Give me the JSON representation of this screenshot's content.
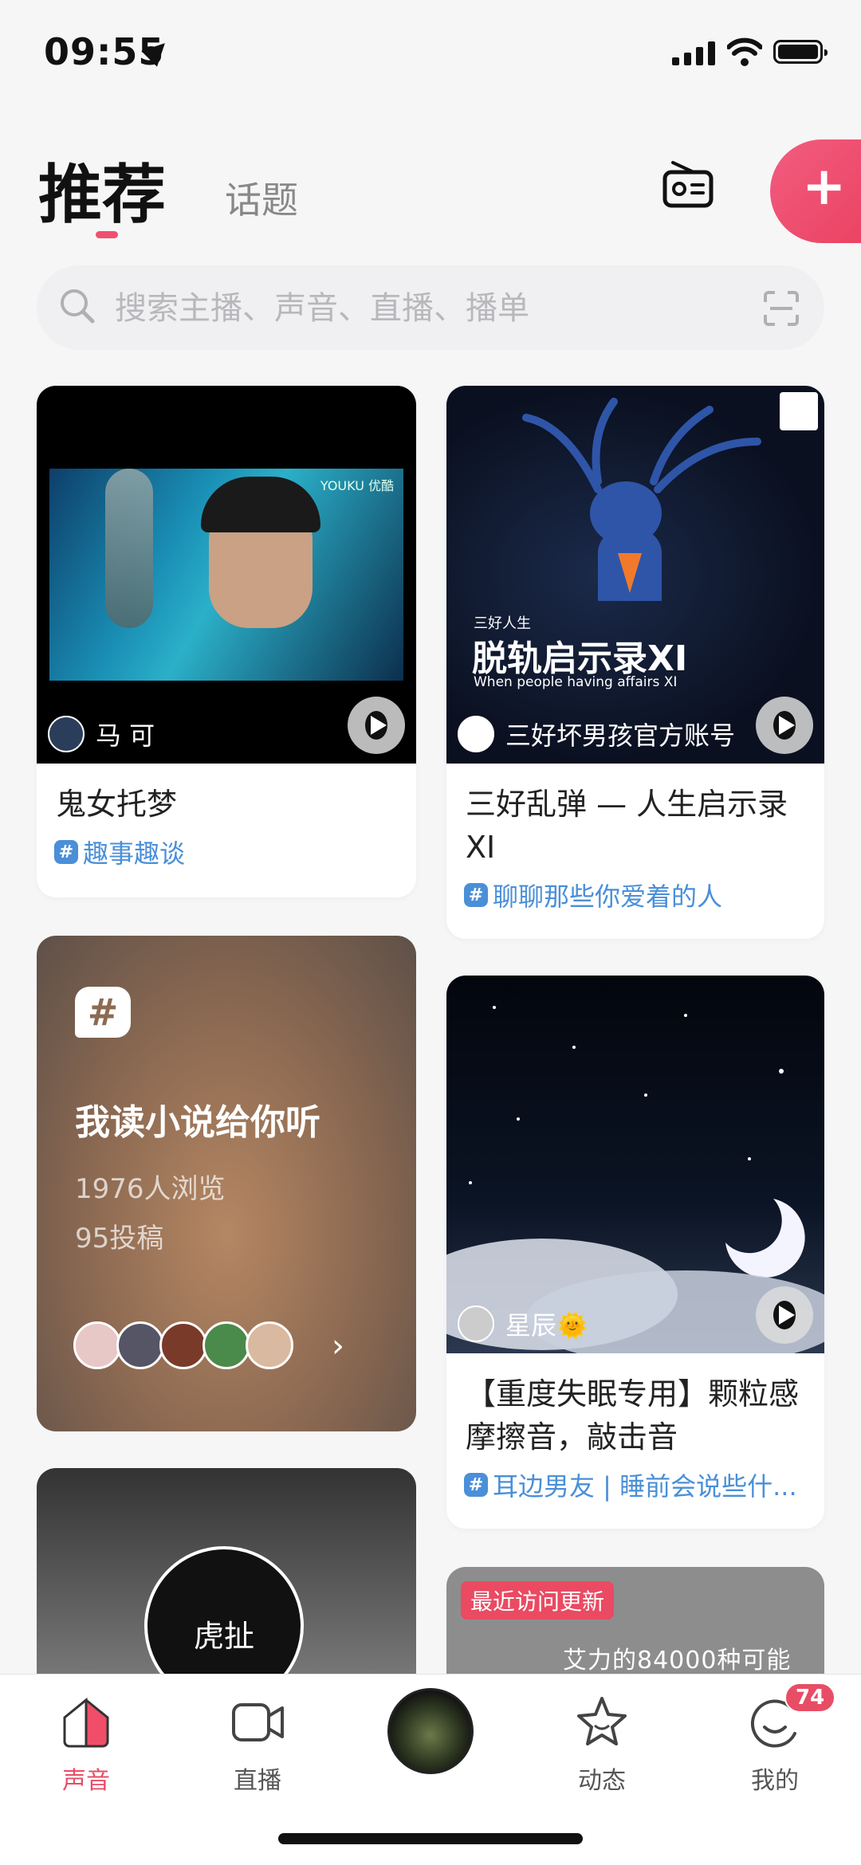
{
  "status_bar": {
    "time": "09:55"
  },
  "header": {
    "tab_active": "推荐",
    "tab_inactive": "话题",
    "accent_color": "#f0506e"
  },
  "search": {
    "placeholder": "搜索主播、声音、直播、播单"
  },
  "feed": {
    "left_card_1": {
      "cover_watermark": "YOUKU 优酷",
      "author": "马 可",
      "title": "鬼女托梦",
      "topic": "趣事趣谈"
    },
    "right_card_1": {
      "cover_kicker": "三好人生",
      "cover_title": "脱轨启示录XI",
      "cover_subtitle": "When people having affairs XI",
      "author": "三好坏男孩官方账号",
      "title": "三好乱弹 — 人生启示录XI",
      "topic": "聊聊那些你爱着的人"
    },
    "topic_card": {
      "title": "我读小说给你听",
      "views": "1976人浏览",
      "posts": "95投稿"
    },
    "right_card_2": {
      "author": "星辰🌞",
      "title": "【重度失眠专用】颗粒感摩擦音，敲击音",
      "topic": "耳边男友 | 睡前会说些什..."
    },
    "left_card_3": {
      "logo_text": "虎扯"
    },
    "right_card_3": {
      "tag": "最近访问更新",
      "text": "艾力的84000种可能"
    }
  },
  "tabbar": {
    "items": [
      {
        "label": "声音",
        "icon": "home-sound-icon",
        "active": true
      },
      {
        "label": "直播",
        "icon": "live-camera-icon",
        "active": false
      },
      {
        "label": "",
        "icon": "play-disc-icon",
        "active": false
      },
      {
        "label": "动态",
        "icon": "star-icon",
        "active": false
      },
      {
        "label": "我的",
        "icon": "profile-icon",
        "active": false,
        "badge": "74"
      }
    ]
  }
}
